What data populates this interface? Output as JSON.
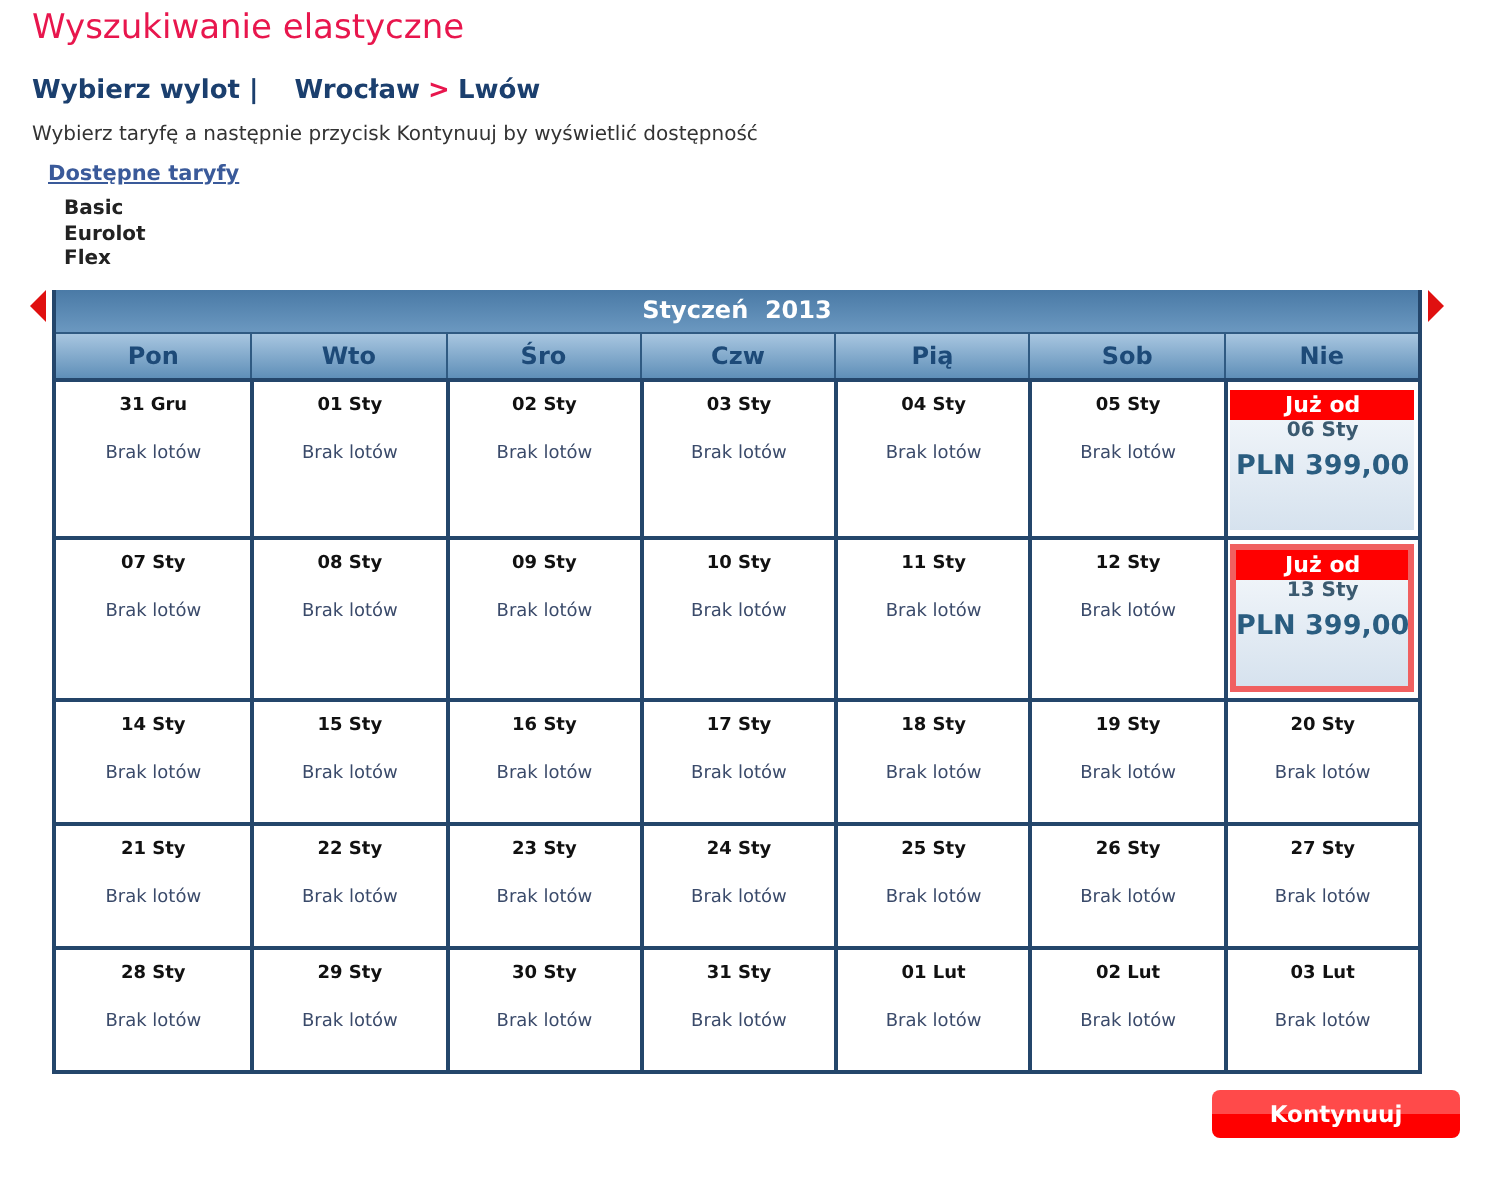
{
  "title": "Wyszukiwanie elastyczne",
  "route": {
    "label": "Wybierz wylot |",
    "from": "Wrocław",
    "separator": ">",
    "to": "Lwów"
  },
  "instruction": "Wybierz taryfę a następnie przycisk Kontynuuj by wyświetlić dostępność",
  "fares_link": "Dostępne taryfy",
  "fares": [
    "Basic",
    "Eurolot",
    "Flex"
  ],
  "calendar": {
    "month": "Styczeń  2013",
    "weekdays": [
      "Pon",
      "Wto",
      "Śro",
      "Czw",
      "Pią",
      "Sob",
      "Nie"
    ],
    "weeks": [
      [
        {
          "kind": "empty",
          "date": "31 Gru",
          "note": "Brak lotów"
        },
        {
          "kind": "empty",
          "date": "01 Sty",
          "note": "Brak lotów"
        },
        {
          "kind": "empty",
          "date": "02 Sty",
          "note": "Brak lotów"
        },
        {
          "kind": "empty",
          "date": "03 Sty",
          "note": "Brak lotów"
        },
        {
          "kind": "empty",
          "date": "04 Sty",
          "note": "Brak lotów"
        },
        {
          "kind": "empty",
          "date": "05 Sty",
          "note": "Brak lotów"
        },
        {
          "kind": "fare",
          "badge": "Już od",
          "date": "06 Sty",
          "price": "PLN 399,00",
          "selected": false
        }
      ],
      [
        {
          "kind": "empty",
          "date": "07 Sty",
          "note": "Brak lotów"
        },
        {
          "kind": "empty",
          "date": "08 Sty",
          "note": "Brak lotów"
        },
        {
          "kind": "empty",
          "date": "09 Sty",
          "note": "Brak lotów"
        },
        {
          "kind": "empty",
          "date": "10 Sty",
          "note": "Brak lotów"
        },
        {
          "kind": "empty",
          "date": "11 Sty",
          "note": "Brak lotów"
        },
        {
          "kind": "empty",
          "date": "12 Sty",
          "note": "Brak lotów"
        },
        {
          "kind": "fare",
          "badge": "Już od",
          "date": "13 Sty",
          "price": "PLN 399,00",
          "selected": true
        }
      ],
      [
        {
          "kind": "empty",
          "date": "14 Sty",
          "note": "Brak lotów"
        },
        {
          "kind": "empty",
          "date": "15 Sty",
          "note": "Brak lotów"
        },
        {
          "kind": "empty",
          "date": "16 Sty",
          "note": "Brak lotów"
        },
        {
          "kind": "empty",
          "date": "17 Sty",
          "note": "Brak lotów"
        },
        {
          "kind": "empty",
          "date": "18 Sty",
          "note": "Brak lotów"
        },
        {
          "kind": "empty",
          "date": "19 Sty",
          "note": "Brak lotów"
        },
        {
          "kind": "empty",
          "date": "20 Sty",
          "note": "Brak lotów"
        }
      ],
      [
        {
          "kind": "empty",
          "date": "21 Sty",
          "note": "Brak lotów"
        },
        {
          "kind": "empty",
          "date": "22 Sty",
          "note": "Brak lotów"
        },
        {
          "kind": "empty",
          "date": "23 Sty",
          "note": "Brak lotów"
        },
        {
          "kind": "empty",
          "date": "24 Sty",
          "note": "Brak lotów"
        },
        {
          "kind": "empty",
          "date": "25 Sty",
          "note": "Brak lotów"
        },
        {
          "kind": "empty",
          "date": "26 Sty",
          "note": "Brak lotów"
        },
        {
          "kind": "empty",
          "date": "27 Sty",
          "note": "Brak lotów"
        }
      ],
      [
        {
          "kind": "empty",
          "date": "28 Sty",
          "note": "Brak lotów"
        },
        {
          "kind": "empty",
          "date": "29 Sty",
          "note": "Brak lotów"
        },
        {
          "kind": "empty",
          "date": "30 Sty",
          "note": "Brak lotów"
        },
        {
          "kind": "empty",
          "date": "31 Sty",
          "note": "Brak lotów"
        },
        {
          "kind": "empty",
          "date": "01 Lut",
          "note": "Brak lotów"
        },
        {
          "kind": "empty",
          "date": "02 Lut",
          "note": "Brak lotów"
        },
        {
          "kind": "empty",
          "date": "03 Lut",
          "note": "Brak lotów"
        }
      ]
    ]
  },
  "continue_button": "Kontynuuj"
}
